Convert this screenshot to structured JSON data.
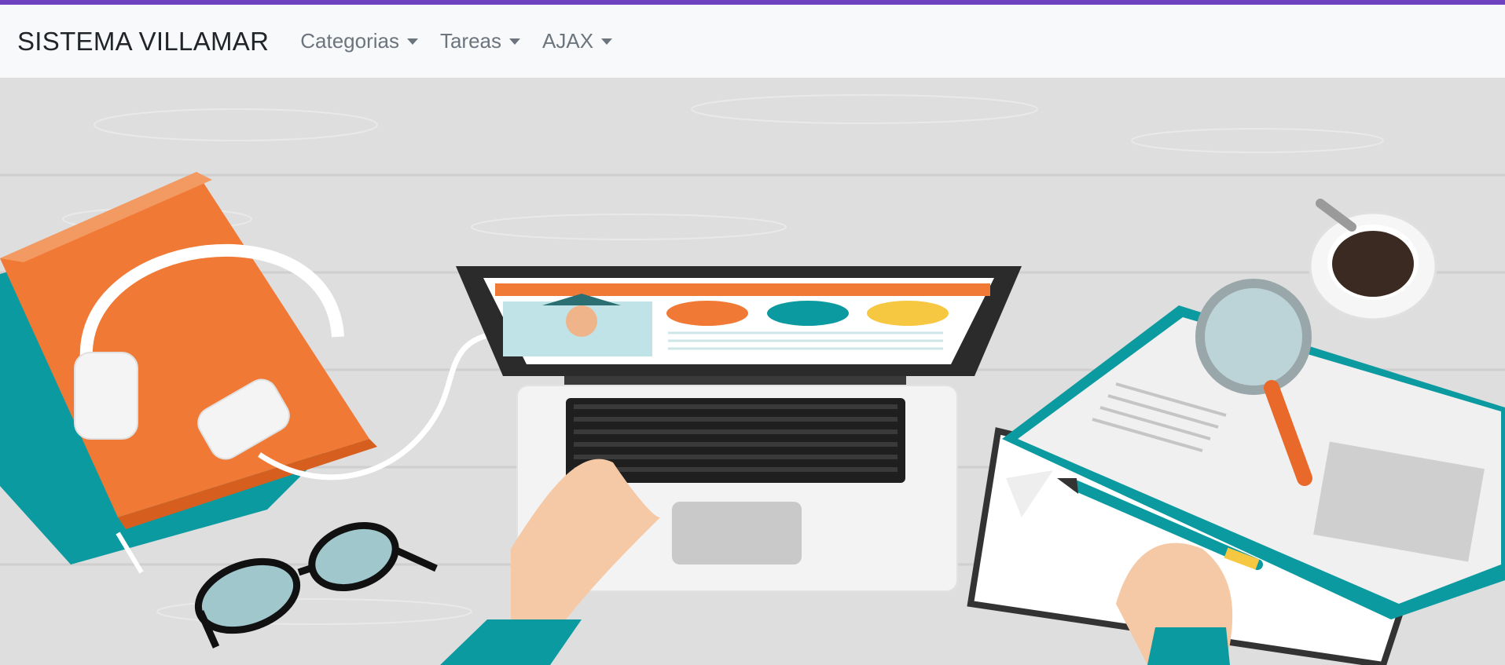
{
  "navbar": {
    "brand": "SISTEMA VILLAMAR",
    "items": [
      {
        "label": "Categorias"
      },
      {
        "label": "Tareas"
      },
      {
        "label": "AJAX"
      }
    ]
  },
  "colors": {
    "top_accent": "#6f42c1",
    "navbar_bg": "#f8f9fa",
    "nav_text": "#6c757d",
    "brand_text": "#212529"
  },
  "hero": {
    "icon": "desk-illustration"
  }
}
